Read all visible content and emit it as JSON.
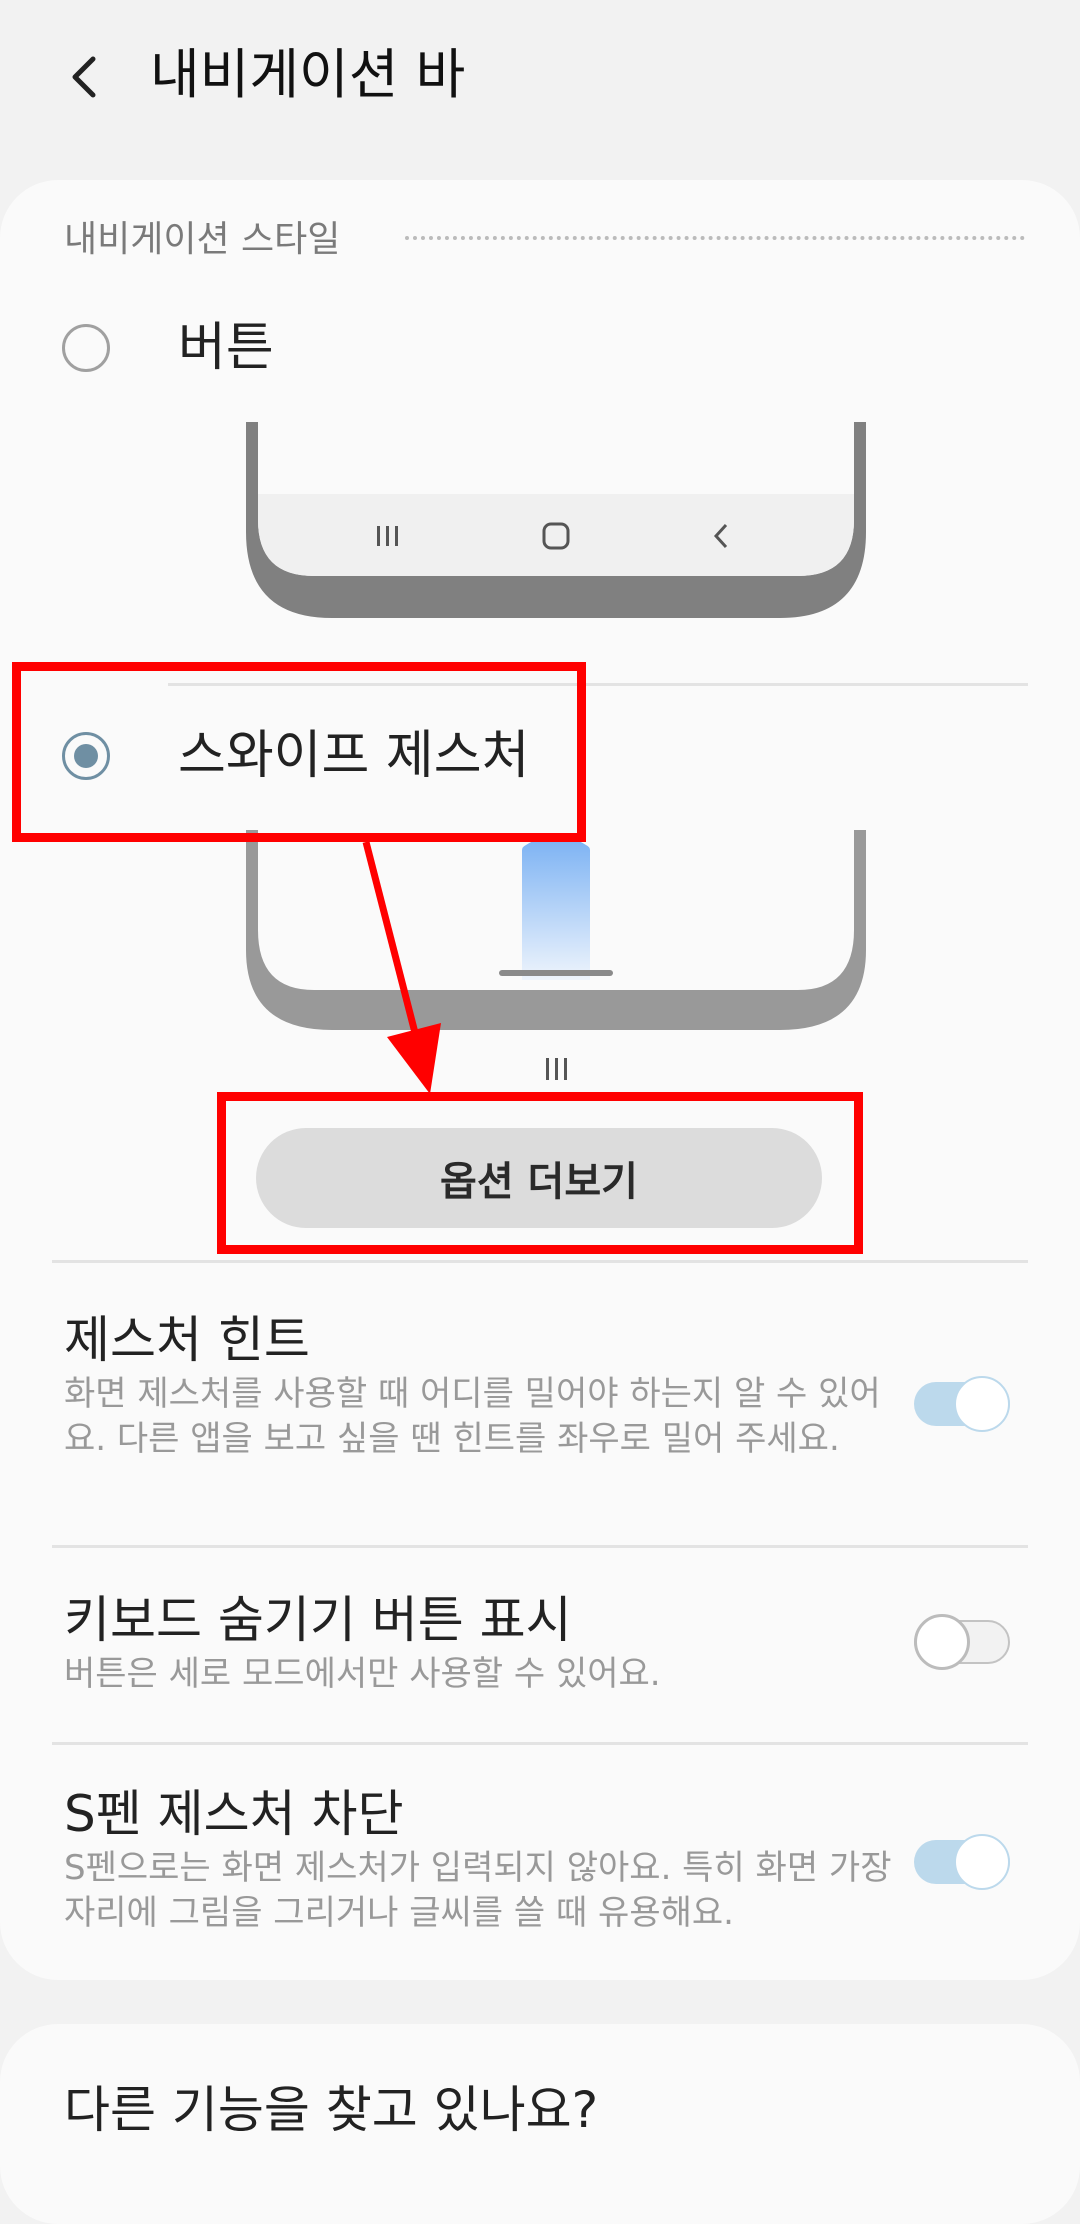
{
  "header": {
    "title": "내비게이션 바"
  },
  "navigation_style": {
    "section_title": "내비게이션 스타일",
    "options": [
      {
        "label": "버튼",
        "selected": false
      },
      {
        "label": "스와이프 제스처",
        "selected": true
      }
    ],
    "more_options_label": "옵션 더보기"
  },
  "settings": [
    {
      "title": "제스처 힌트",
      "description": "화면 제스처를 사용할 때 어디를 밀어야 하는지 알 수 있어요. 다른 앱을 보고 싶을 땐 힌트를 좌우로 밀어 주세요.",
      "toggle_on": true
    },
    {
      "title": "키보드 숨기기 버튼 표시",
      "description": "버튼은 세로 모드에서만 사용할 수 있어요.",
      "toggle_on": false
    },
    {
      "title": "S펜 제스처 차단",
      "description": "S펜으로는 화면 제스처가 입력되지 않아요. 특히 화면 가장자리에 그림을 그리거나 글씨를 쓸 때 유용해요.",
      "toggle_on": true
    }
  ],
  "footer_card": {
    "title": "다른 기능을 찾고 있나요?"
  },
  "colors": {
    "accent": "#6f8fa3",
    "toggle_on": "#bcd9ec",
    "annotation": "#ff0000"
  }
}
